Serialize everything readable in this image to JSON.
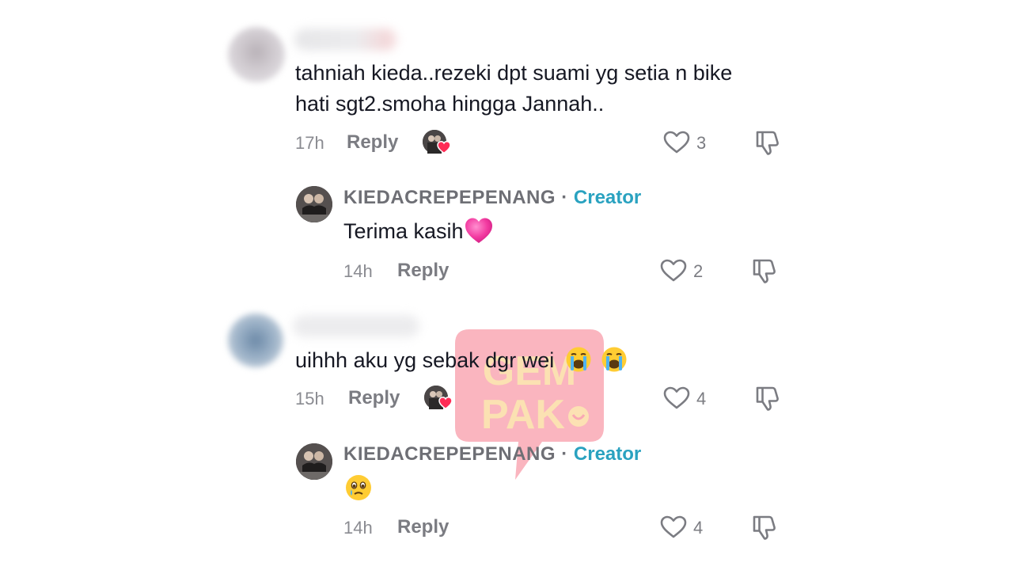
{
  "comments": [
    {
      "text_lines": [
        "tahniah kieda..rezeki dpt suami yg setia n bike",
        "hati sgt2.smoha hingga Jannah.."
      ],
      "time": "17h",
      "reply_label": "Reply",
      "likes": "3",
      "creator_liked": true,
      "reply": {
        "author": "KIEDACREPEPENANG",
        "separator": "·",
        "badge": "Creator",
        "text": "Terima kasih",
        "emoji": "growing-heart",
        "time": "14h",
        "reply_label": "Reply",
        "likes": "2"
      }
    },
    {
      "text_lines": [
        "uihhh aku yg sebak dgr wei"
      ],
      "emoji": [
        "loudly-crying-face",
        "loudly-crying-face"
      ],
      "time": "15h",
      "reply_label": "Reply",
      "likes": "4",
      "creator_liked": true,
      "reply": {
        "author": "KIEDACREPEPENANG",
        "separator": "·",
        "badge": "Creator",
        "text": "",
        "emoji": "face-holding-back-tears",
        "time": "14h",
        "reply_label": "Reply",
        "likes": "4"
      }
    }
  ],
  "watermark": {
    "line1": "GEM",
    "line2": "PAK"
  },
  "colors": {
    "creator_badge": "#2aa2c0",
    "meta_grey": "#8a8b91",
    "like_heart_red": "#fe2c55",
    "watermark_pink": "#f9a8b4"
  }
}
